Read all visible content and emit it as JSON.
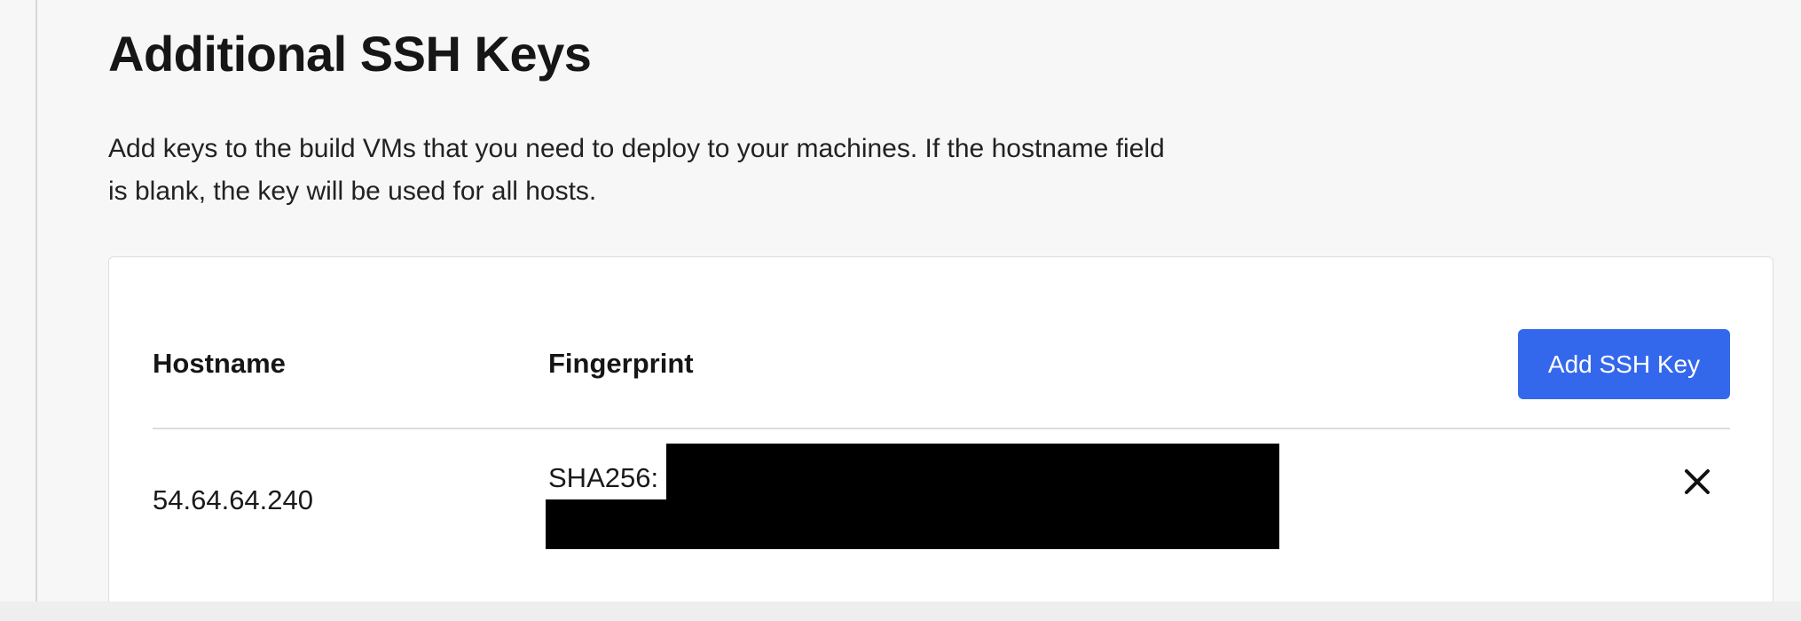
{
  "section": {
    "title": "Additional SSH Keys",
    "description": "Add keys to the build VMs that you need to deploy to your machines. If the hostname field is blank, the key will be used for all hosts."
  },
  "table": {
    "columns": [
      "Hostname",
      "Fingerprint"
    ],
    "add_button_label": "Add SSH Key",
    "rows": [
      {
        "hostname": "54.64.64.240",
        "fingerprint_prefix": "SHA256:",
        "fingerprint_redacted": true,
        "delete_icon": "close-icon"
      }
    ]
  },
  "colors": {
    "accent": "#3468ec",
    "background": "#f7f7f7",
    "card": "#ffffff",
    "redaction": "#000000"
  }
}
